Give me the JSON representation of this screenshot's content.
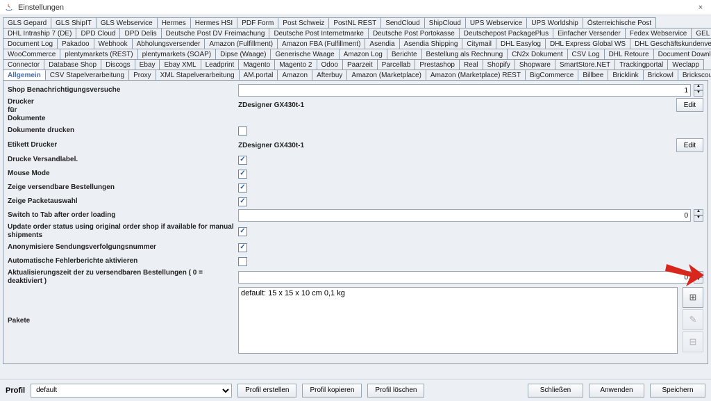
{
  "window": {
    "title": "Einstellungen",
    "close": "×"
  },
  "tabRows": [
    [
      "GLS Gepard",
      "GLS ShipIT",
      "GLS Webservice",
      "Hermes",
      "Hermes HSI",
      "PDF Form",
      "Post Schweiz",
      "PostNL REST",
      "SendCloud",
      "ShipCloud",
      "UPS Webservice",
      "UPS Worldship",
      "Österreichische Post"
    ],
    [
      "DHL Intraship 7 (DE)",
      "DPD Cloud",
      "DPD Delis",
      "Deutsche Post DV Freimachung",
      "Deutsche Post Internetmarke",
      "Deutsche Post Portokasse",
      "Deutschepost PackagePlus",
      "Einfacher Versender",
      "Fedex Webservice",
      "GEL Express"
    ],
    [
      "Document Log",
      "Pakadoo",
      "Webhook",
      "Abholungsversender",
      "Amazon (Fulfillment)",
      "Amazon FBA (Fulfillment)",
      "Asendia",
      "Asendia Shipping",
      "Citymail",
      "DHL Easylog",
      "DHL Express Global WS",
      "DHL Geschäftskundenversand"
    ],
    [
      "WooCommerce",
      "plentymarkets (REST)",
      "plentymarkets (SOAP)",
      "Dipse (Waage)",
      "Generische Waage",
      "Amazon Log",
      "Berichte",
      "Bestellung als Rechnung",
      "CN2x Dokument",
      "CSV Log",
      "DHL Retoure",
      "Document Downloader"
    ],
    [
      "Connector",
      "Database Shop",
      "Discogs",
      "Ebay",
      "Ebay XML",
      "Leadprint",
      "Magento",
      "Magento 2",
      "Odoo",
      "Paarzeit",
      "Parcellab",
      "Prestashop",
      "Real",
      "Shopify",
      "Shopware",
      "SmartStore.NET",
      "Trackingportal",
      "Weclapp"
    ],
    [
      "Allgemein",
      "CSV Stapelverarbeitung",
      "Proxy",
      "XML Stapelverarbeitung",
      "AM.portal",
      "Amazon",
      "Afterbuy",
      "Amazon (Marketplace)",
      "Amazon (Marketplace) REST",
      "BigCommerce",
      "Billbee",
      "Bricklink",
      "Brickowl",
      "Brickscout"
    ]
  ],
  "selectedTab": "Allgemein",
  "form": {
    "shopNotif": {
      "label": "Shop Benachrichtigungsversuche",
      "value": "1"
    },
    "docPrinter": {
      "label": "Drucker\nfür\nDokumente",
      "value": "ZDesigner GX430t-1",
      "editBtn": "Edit"
    },
    "printDocs": {
      "label": "Dokumente drucken",
      "checked": false
    },
    "labelPrinter": {
      "label": "Etikett Drucker",
      "value": "ZDesigner GX430t-1",
      "editBtn": "Edit"
    },
    "printShip": {
      "label": "Drucke Versandlabel.",
      "checked": true
    },
    "mouse": {
      "label": "Mouse Mode",
      "checked": true
    },
    "showShip": {
      "label": "Zeige versendbare Bestellungen",
      "checked": true
    },
    "showPkg": {
      "label": "Zeige Packetauswahl",
      "checked": true
    },
    "switchTab": {
      "label": "Switch to Tab after order loading",
      "value": "0"
    },
    "updStatus": {
      "label": "Update order status using original order shop if available for manual shipments",
      "checked": true
    },
    "anon": {
      "label": "Anonymisiere Sendungsverfolgungsnummer",
      "checked": true
    },
    "autoErr": {
      "label": "Automatische Fehlerberichte aktivieren",
      "checked": false
    },
    "refresh": {
      "label": "Aktualisierungszeit der zu versendbaren Bestellungen ( 0 = deaktiviert )",
      "value": "0"
    },
    "packages": {
      "label": "Pakete",
      "items": [
        "default: 15 x 15 x 10 cm 0,1 kg"
      ],
      "add": "⊞",
      "edit": "✎",
      "del": "⊟"
    }
  },
  "footer": {
    "profileLabel": "Profil",
    "profileValue": "default",
    "createProfile": "Profil erstellen",
    "copyProfile": "Profil kopieren",
    "deleteProfile": "Profil löschen",
    "close": "Schließen",
    "apply": "Anwenden",
    "save": "Speichern"
  }
}
